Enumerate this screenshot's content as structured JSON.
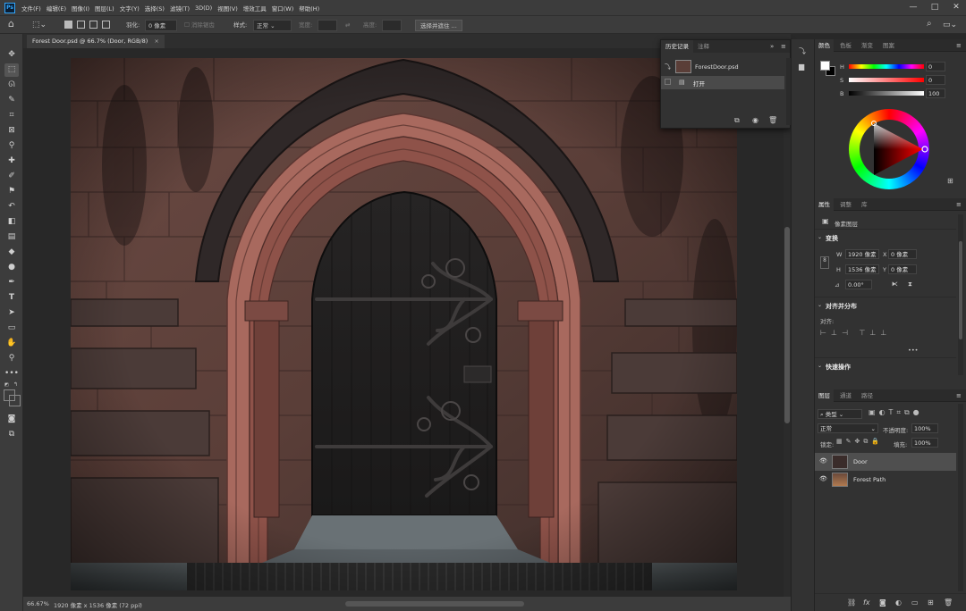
{
  "app_logo": "Ps",
  "menu": [
    "文件(F)",
    "编辑(E)",
    "图像(I)",
    "图层(L)",
    "文字(Y)",
    "选择(S)",
    "滤镜(T)",
    "3D(D)",
    "视图(V)",
    "增效工具",
    "窗口(W)",
    "帮助(H)"
  ],
  "window_controls": [
    "—",
    "□",
    "✕"
  ],
  "options_bar": {
    "feather_label": "羽化:",
    "feather_value": "0 像素",
    "antialias_label": "消除锯齿",
    "style_label": "样式:",
    "style_value": "正常",
    "width_label": "宽度:",
    "height_label": "高度:",
    "select_mask_button": "选择并遮住 ..."
  },
  "document_tab": {
    "title": "Forest Door.psd @ 66.7% (Door, RGB/8)",
    "close": "×"
  },
  "status_bar": {
    "zoom": "66.67%",
    "doc_info": "1920 像素 x 1536 像素 (72 ppi)"
  },
  "history_panel": {
    "tabs": [
      "历史记录",
      "注释"
    ],
    "snapshot": "ForestDoor.psd",
    "steps": [
      "打开"
    ]
  },
  "color_panel": {
    "tabs": [
      "颜色",
      "色板",
      "渐变",
      "图案"
    ],
    "sliders": [
      {
        "label": "H",
        "value": "0",
        "fill": 0
      },
      {
        "label": "S",
        "value": "0",
        "fill": 0
      },
      {
        "label": "B",
        "value": "100",
        "fill": 1.0
      }
    ]
  },
  "properties_panel": {
    "tabs": [
      "属性",
      "调整",
      "库"
    ],
    "layer_type": "像素图层",
    "transform_title": "变换",
    "w_label": "W",
    "w_value": "1920 像素",
    "h_label": "H",
    "h_value": "1536 像素",
    "x_label": "X",
    "x_value": "0 像素",
    "y_label": "Y",
    "y_value": "0 像素",
    "angle_value": "0.00°",
    "align_title": "对齐并分布",
    "align_label": "对齐:",
    "more": "•••",
    "quick_title": "快速操作"
  },
  "layers_panel": {
    "tabs": [
      "图层",
      "通道",
      "路径"
    ],
    "filter_kind": "类型",
    "blend_mode": "正常",
    "opacity_label": "不透明度:",
    "opacity_value": "100%",
    "lock_label": "锁定:",
    "fill_label": "填充:",
    "fill_value": "100%",
    "layers": [
      {
        "name": "Door",
        "selected": true
      },
      {
        "name": "Forest Path",
        "selected": false
      }
    ],
    "bottom_icons": [
      "link-icon",
      "fx-icon",
      "mask-icon",
      "adjustment-icon",
      "folder-icon",
      "new-layer-icon",
      "trash-icon"
    ]
  },
  "colors": {
    "foreground": "#ffffff",
    "background": "#000000",
    "accent": "#31a8ff"
  }
}
